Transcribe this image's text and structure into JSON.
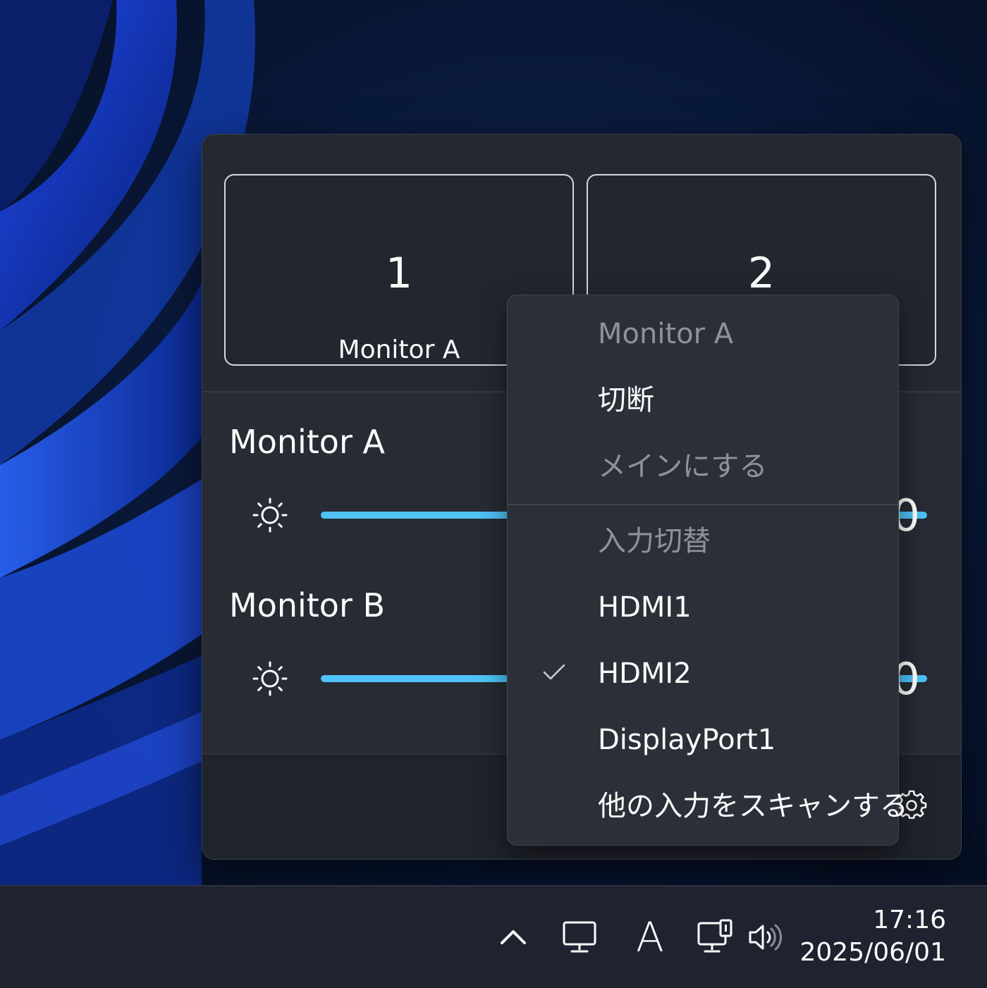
{
  "tiles": [
    {
      "number": "1",
      "name": "Monitor A"
    },
    {
      "number": "2",
      "name": ""
    }
  ],
  "monitors": [
    {
      "title": "Monitor A",
      "brightness": 100,
      "value_text": "100"
    },
    {
      "title": "Monitor B",
      "brightness": 100,
      "value_text": "100"
    }
  ],
  "context_menu": {
    "header": "Monitor A",
    "disconnect": "切断",
    "make_main": "メインにする",
    "input_header": "入力切替",
    "inputs": [
      {
        "label": "HDMI1",
        "checked": false
      },
      {
        "label": "HDMI2",
        "checked": true
      },
      {
        "label": "DisplayPort1",
        "checked": false
      }
    ],
    "scan": "他の入力をスキャンする"
  },
  "taskbar": {
    "ime": "A",
    "time": "17:16",
    "date": "2025/06/01"
  },
  "colors": {
    "accent": "#4fc3f7",
    "flyout_bg": "#22262f",
    "menu_bg": "#2b2f38",
    "taskbar_bg": "#1f2330"
  },
  "icons": [
    "sun-icon",
    "settings-gear-icon",
    "chevron-up-icon",
    "monitor-icon",
    "network-monitor-icon",
    "volume-icon",
    "checkmark-icon"
  ]
}
